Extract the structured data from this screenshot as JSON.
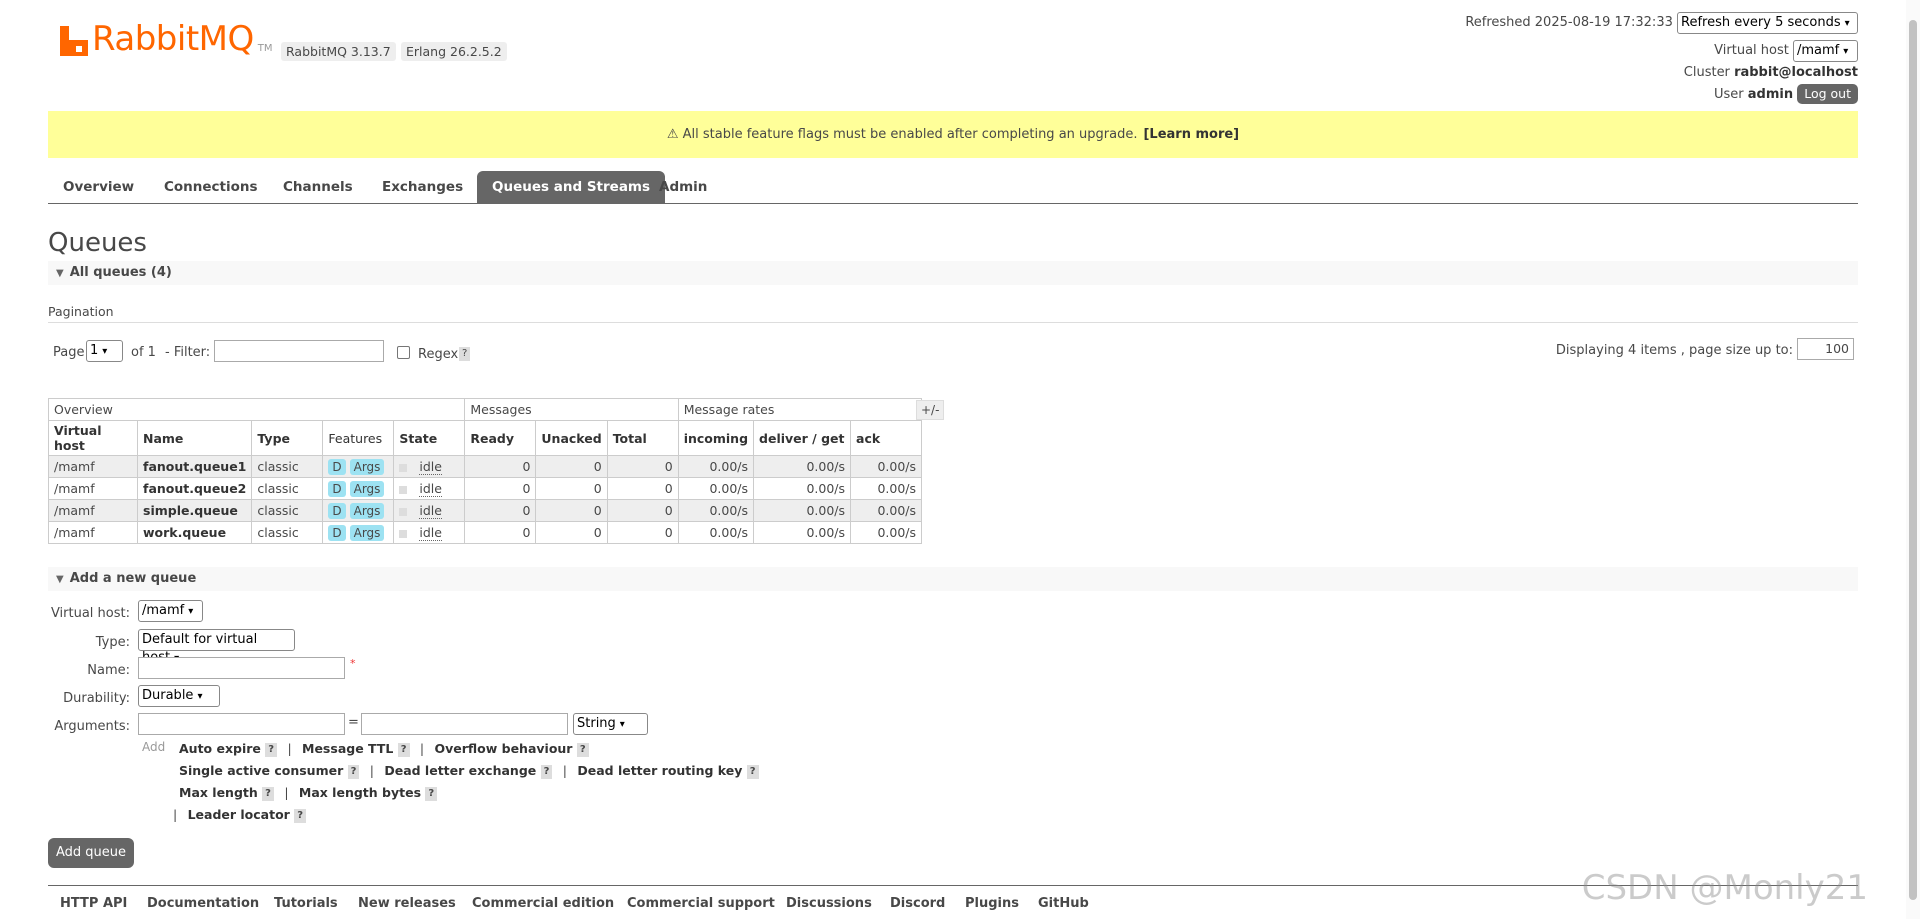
{
  "header": {
    "logo_text": "RabbitMQ",
    "logo_tm": "TM",
    "version": "RabbitMQ 3.13.7",
    "erlang": "Erlang 26.2.5.2",
    "refreshed_label": "Refreshed 2025-08-19 17:32:33",
    "refresh_option": "Refresh every 5 seconds",
    "vhost_label": "Virtual host",
    "vhost_value": "/mamf",
    "cluster_label": "Cluster",
    "cluster_value": "rabbit@localhost",
    "user_label": "User",
    "user_value": "admin",
    "logout": "Log out"
  },
  "banner": {
    "text": "⚠ All stable feature flags must be enabled after completing an upgrade.",
    "link": "[Learn more]"
  },
  "tabs": [
    "Overview",
    "Connections",
    "Channels",
    "Exchanges",
    "Queues and Streams",
    "Admin"
  ],
  "page_title": "Queues",
  "all_queues": "All queues (4)",
  "pagination": {
    "heading": "Pagination",
    "page_label": "Page",
    "page_value": "1",
    "of_label": "of 1",
    "filter_label": "- Filter:",
    "regex_label": "Regex",
    "help": "?",
    "displaying": "Displaying 4 items , page size up to:",
    "page_size": "100"
  },
  "table": {
    "groups": [
      "Overview",
      "Messages",
      "Message rates"
    ],
    "columns": [
      "Virtual host",
      "Name",
      "Type",
      "Features",
      "State",
      "Ready",
      "Unacked",
      "Total",
      "incoming",
      "deliver / get",
      "ack"
    ],
    "plus_minus": "+/-",
    "rows": [
      {
        "vhost": "/mamf",
        "name": "fanout.queue1",
        "type": "classic",
        "f1": "D",
        "f2": "Args",
        "state": "idle",
        "ready": "0",
        "unacked": "0",
        "total": "0",
        "incoming": "0.00/s",
        "deliver": "0.00/s",
        "ack": "0.00/s"
      },
      {
        "vhost": "/mamf",
        "name": "fanout.queue2",
        "type": "classic",
        "f1": "D",
        "f2": "Args",
        "state": "idle",
        "ready": "0",
        "unacked": "0",
        "total": "0",
        "incoming": "0.00/s",
        "deliver": "0.00/s",
        "ack": "0.00/s"
      },
      {
        "vhost": "/mamf",
        "name": "simple.queue",
        "type": "classic",
        "f1": "D",
        "f2": "Args",
        "state": "idle",
        "ready": "0",
        "unacked": "0",
        "total": "0",
        "incoming": "0.00/s",
        "deliver": "0.00/s",
        "ack": "0.00/s"
      },
      {
        "vhost": "/mamf",
        "name": "work.queue",
        "type": "classic",
        "f1": "D",
        "f2": "Args",
        "state": "idle",
        "ready": "0",
        "unacked": "0",
        "total": "0",
        "incoming": "0.00/s",
        "deliver": "0.00/s",
        "ack": "0.00/s"
      }
    ]
  },
  "add_queue": {
    "heading": "Add a new queue",
    "vhost_label": "Virtual host:",
    "vhost_value": "/mamf",
    "type_label": "Type:",
    "type_value": "Default for virtual host",
    "name_label": "Name:",
    "required_mark": "*",
    "durability_label": "Durability:",
    "durability_value": "Durable",
    "arguments_label": "Arguments:",
    "equals": "=",
    "arg_type": "String",
    "add_label": "Add",
    "arg_links": {
      "auto_expire": "Auto expire",
      "message_ttl": "Message TTL",
      "overflow": "Overflow behaviour",
      "single_active": "Single active consumer",
      "dlx": "Dead letter exchange",
      "dlrk": "Dead letter routing key",
      "max_length": "Max length",
      "max_length_bytes": "Max length bytes",
      "leader_locator": "Leader locator",
      "sep": "|"
    },
    "submit": "Add queue"
  },
  "footer": [
    "HTTP API",
    "Documentation",
    "Tutorials",
    "New releases",
    "Commercial edition",
    "Commercial support",
    "Discussions",
    "Discord",
    "Plugins",
    "GitHub"
  ],
  "watermark": "CSDN @Monly21"
}
